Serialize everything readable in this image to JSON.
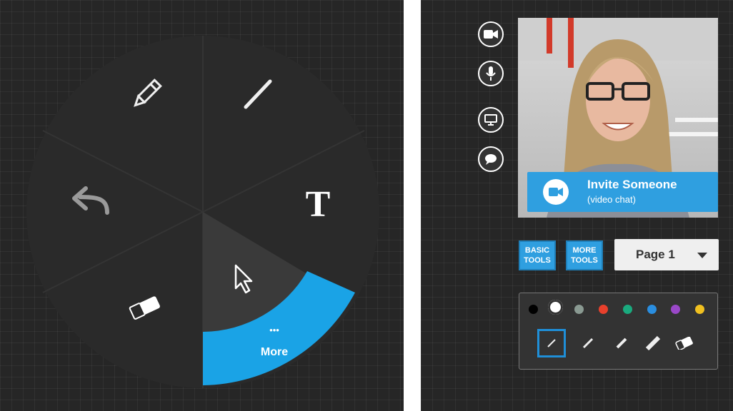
{
  "radial_menu": {
    "items": [
      {
        "name": "pencil",
        "icon": "pencil-icon"
      },
      {
        "name": "line",
        "icon": "line-icon"
      },
      {
        "name": "text",
        "icon": "text-icon"
      },
      {
        "name": "undo",
        "icon": "undo-icon"
      },
      {
        "name": "eraser",
        "icon": "eraser-icon"
      },
      {
        "name": "select",
        "icon": "cursor-icon"
      }
    ],
    "more": {
      "dots": "•••",
      "label": "More"
    }
  },
  "side_controls": [
    {
      "name": "video-camera",
      "icon": "video-camera-icon"
    },
    {
      "name": "microphone",
      "icon": "microphone-icon"
    },
    {
      "name": "screen-share",
      "icon": "monitor-icon"
    },
    {
      "name": "chat",
      "icon": "chat-bubble-icon"
    }
  ],
  "invite": {
    "title": "Invite Someone",
    "subtitle": "(video chat)"
  },
  "tools": {
    "basic_line1": "BASIC",
    "basic_line2": "TOOLS",
    "more_line1": "MORE",
    "more_line2": "TOOLS"
  },
  "page_select": {
    "value": "Page 1"
  },
  "palette": {
    "colors": [
      "#000000",
      "#ffffff",
      "#8a9a92",
      "#e8402c",
      "#1aaa7e",
      "#2a8ee0",
      "#9a48c8",
      "#f0c020"
    ],
    "selected_color_index": 1,
    "pens": [
      "pen-extra-fine",
      "pen-fine",
      "pen-medium",
      "pen-large",
      "eraser"
    ],
    "selected_pen_index": 0
  },
  "colors": {
    "accent": "#2f9fe0",
    "background": "#262626"
  }
}
